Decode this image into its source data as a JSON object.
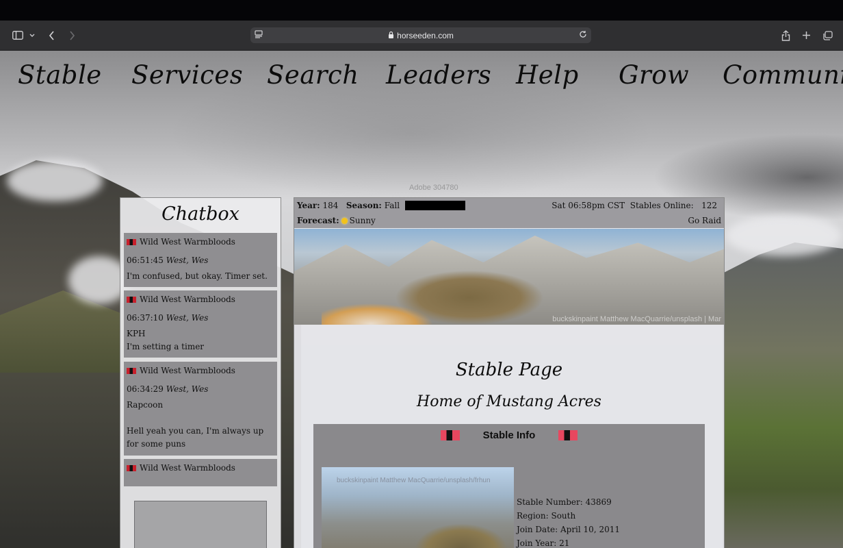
{
  "browser": {
    "url": "horseeden.com"
  },
  "nav": [
    "Stable",
    "Services",
    "Search",
    "Leaders",
    "Help",
    "Grow",
    "Community"
  ],
  "watermark": "Adobe 304780",
  "chatbox": {
    "title": "Chatbox",
    "messages": [
      {
        "stable": "Wild West Warmbloods",
        "time": "06:51:45",
        "author": "West, Wes",
        "lines": [
          "I'm confused, but okay. Timer set."
        ]
      },
      {
        "stable": "Wild West Warmbloods",
        "time": "06:37:10",
        "author": "West, Wes",
        "lines": [
          "KPH",
          "I'm setting a timer"
        ]
      },
      {
        "stable": "Wild West Warmbloods",
        "time": "06:34:29",
        "author": "West, Wes",
        "lines": [
          "Rapcoon",
          "",
          "Hell yeah you can, I'm always up for some puns"
        ]
      },
      {
        "stable": "Wild West Warmbloods",
        "time": "",
        "author": "",
        "lines": []
      }
    ]
  },
  "status": {
    "year_label": "Year:",
    "year": "184",
    "season_label": "Season:",
    "season": "Fall",
    "datetime": "Sat 06:58pm CST",
    "online_label": "Stables Online:",
    "online": "122",
    "forecast_label": "Forecast:",
    "forecast": "Sunny",
    "raid": "Go Raid"
  },
  "banner_credit": "buckskinpaint Matthew MacQuarrie/unsplash | Mar",
  "page": {
    "title": "Stable Page",
    "subtitle": "Home of Mustang Acres"
  },
  "stable_info": {
    "heading": "Stable Info",
    "image_credit": "buckskinpaint Matthew MacQuarrie/unsplash/frhun",
    "lines": [
      "Stable Number: 43869",
      "Region: South",
      "Join Date: April 10, 2011",
      "Join Year: 21"
    ]
  },
  "colors": {
    "chrome": "#2f2f31",
    "flag_red": "#c8202c",
    "flag_pink": "#e8475f"
  }
}
